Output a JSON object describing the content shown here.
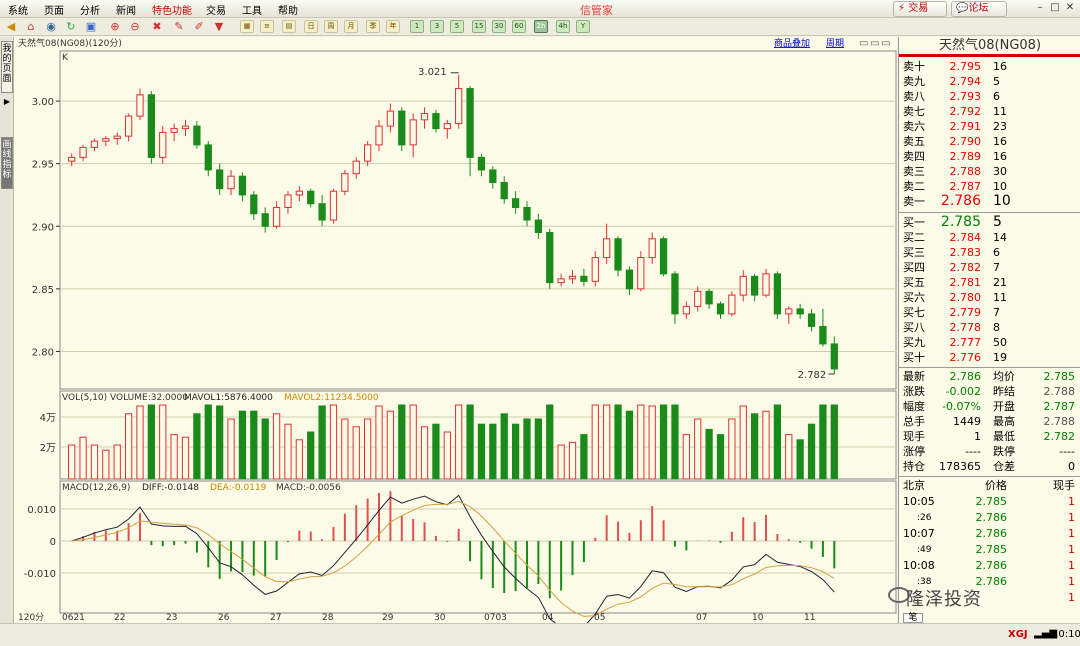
{
  "menu": [
    "系统",
    "页面",
    "分析",
    "新闻",
    "特色功能",
    "交易",
    "工具",
    "帮助"
  ],
  "app_title": "信管家",
  "trade_button": "交易",
  "forum_button": "论坛",
  "toolbar": {
    "icons": [
      "arrow-left-icon",
      "home-icon",
      "globe-icon",
      "refresh-icon",
      "zoom-in-icon",
      "zoom-out-icon",
      "pencil-icon",
      "paint-icon",
      "funnel-icon",
      "grid-icon",
      "list-icon",
      "chart-icon",
      "calendar-icon",
      "week-icon",
      "month-icon",
      "bar-icon"
    ],
    "periods": [
      "1",
      "3",
      "5",
      "15",
      "30",
      "60",
      "2h",
      "4h",
      "Y"
    ],
    "selected_period": "2h"
  },
  "left_tabs": [
    "我的页面",
    "画线指标"
  ],
  "chart": {
    "header_text": "天然气08(NG08)(120分)",
    "k_label": "K",
    "overlay_label": "商品叠加",
    "cycle_label": "周期",
    "price_axis": [
      "3.00",
      "2.95",
      "2.90",
      "2.85",
      "2.80"
    ],
    "high_annotation": "3.021",
    "low_annotation": "2.782",
    "vol_header": {
      "name": "VOL(5,10) VOLUME:32.0000",
      "mavol1": "MAVOL1:5876.4000",
      "mavol2": "MAVOL2:11234.5000"
    },
    "vol_axis": [
      "4万",
      "2万"
    ],
    "macd_header": {
      "name": "MACD(12,26,9)",
      "diff": "DIFF:-0.0148",
      "dea": "DEA:-0.0119",
      "macd": "MACD:-0.0056"
    },
    "macd_axis": [
      "0.010",
      "0",
      "-0.010"
    ],
    "date_axis": {
      "period": "120分",
      "labels": [
        "0621",
        "22",
        "23",
        "26",
        "27",
        "28",
        "29",
        "30",
        "0703",
        "04",
        "05",
        "07",
        "10",
        "11"
      ]
    }
  },
  "chart_data": {
    "type": "candlestick",
    "title": "天然气08(NG08)(120分)",
    "ylim": [
      2.77,
      3.04
    ],
    "notes": "Approximate OHLC values read from 120-minute candlestick chart",
    "candles": [
      [
        2.952,
        2.958,
        2.948,
        2.955
      ],
      [
        2.955,
        2.965,
        2.952,
        2.963
      ],
      [
        2.963,
        2.97,
        2.96,
        2.968
      ],
      [
        2.968,
        2.972,
        2.964,
        2.97
      ],
      [
        2.97,
        2.975,
        2.965,
        2.972
      ],
      [
        2.972,
        2.99,
        2.968,
        2.988
      ],
      [
        2.988,
        3.01,
        2.985,
        3.005
      ],
      [
        3.005,
        3.008,
        2.95,
        2.955
      ],
      [
        2.955,
        2.98,
        2.95,
        2.975
      ],
      [
        2.975,
        2.982,
        2.968,
        2.978
      ],
      [
        2.978,
        2.985,
        2.972,
        2.98
      ],
      [
        2.98,
        2.984,
        2.962,
        2.965
      ],
      [
        2.965,
        2.968,
        2.94,
        2.945
      ],
      [
        2.945,
        2.95,
        2.925,
        2.93
      ],
      [
        2.93,
        2.945,
        2.925,
        2.94
      ],
      [
        2.94,
        2.943,
        2.92,
        2.925
      ],
      [
        2.925,
        2.928,
        2.905,
        2.91
      ],
      [
        2.91,
        2.915,
        2.895,
        2.9
      ],
      [
        2.9,
        2.92,
        2.898,
        2.915
      ],
      [
        2.915,
        2.928,
        2.91,
        2.925
      ],
      [
        2.925,
        2.932,
        2.92,
        2.928
      ],
      [
        2.928,
        2.93,
        2.915,
        2.918
      ],
      [
        2.918,
        2.925,
        2.9,
        2.905
      ],
      [
        2.905,
        2.93,
        2.902,
        2.928
      ],
      [
        2.928,
        2.945,
        2.925,
        2.942
      ],
      [
        2.942,
        2.955,
        2.938,
        2.952
      ],
      [
        2.952,
        2.968,
        2.948,
        2.965
      ],
      [
        2.965,
        2.985,
        2.96,
        2.98
      ],
      [
        2.98,
        2.998,
        2.975,
        2.992
      ],
      [
        2.992,
        2.995,
        2.96,
        2.965
      ],
      [
        2.965,
        2.99,
        2.955,
        2.985
      ],
      [
        2.985,
        2.995,
        2.978,
        2.99
      ],
      [
        2.99,
        2.993,
        2.975,
        2.978
      ],
      [
        2.978,
        2.985,
        2.97,
        2.982
      ],
      [
        2.982,
        3.021,
        2.978,
        3.01
      ],
      [
        3.01,
        3.012,
        2.94,
        2.955
      ],
      [
        2.955,
        2.958,
        2.94,
        2.945
      ],
      [
        2.945,
        2.948,
        2.93,
        2.935
      ],
      [
        2.935,
        2.94,
        2.918,
        2.922
      ],
      [
        2.922,
        2.928,
        2.91,
        2.915
      ],
      [
        2.915,
        2.92,
        2.9,
        2.905
      ],
      [
        2.905,
        2.91,
        2.89,
        2.895
      ],
      [
        2.895,
        2.898,
        2.85,
        2.855
      ],
      [
        2.855,
        2.862,
        2.852,
        2.858
      ],
      [
        2.858,
        2.865,
        2.854,
        2.86
      ],
      [
        2.86,
        2.866,
        2.852,
        2.856
      ],
      [
        2.856,
        2.88,
        2.852,
        2.875
      ],
      [
        2.875,
        2.902,
        2.87,
        2.89
      ],
      [
        2.89,
        2.892,
        2.86,
        2.865
      ],
      [
        2.865,
        2.868,
        2.845,
        2.85
      ],
      [
        2.85,
        2.88,
        2.848,
        2.875
      ],
      [
        2.875,
        2.895,
        2.87,
        2.89
      ],
      [
        2.89,
        2.892,
        2.86,
        2.862
      ],
      [
        2.862,
        2.864,
        2.822,
        2.83
      ],
      [
        2.83,
        2.84,
        2.826,
        2.836
      ],
      [
        2.836,
        2.852,
        2.832,
        2.848
      ],
      [
        2.848,
        2.85,
        2.834,
        2.838
      ],
      [
        2.838,
        2.84,
        2.826,
        2.83
      ],
      [
        2.83,
        2.848,
        2.828,
        2.845
      ],
      [
        2.845,
        2.865,
        2.84,
        2.86
      ],
      [
        2.86,
        2.862,
        2.84,
        2.845
      ],
      [
        2.845,
        2.866,
        2.843,
        2.862
      ],
      [
        2.862,
        2.864,
        2.826,
        2.83
      ],
      [
        2.83,
        2.836,
        2.822,
        2.834
      ],
      [
        2.834,
        2.838,
        2.826,
        2.83
      ],
      [
        2.83,
        2.834,
        2.816,
        2.82
      ],
      [
        2.82,
        2.834,
        2.804,
        2.806
      ],
      [
        2.806,
        2.812,
        2.782,
        2.786
      ]
    ]
  },
  "quote": {
    "title": "天然气08(NG08)",
    "asks": [
      {
        "label": "卖十",
        "price": "2.795",
        "vol": "16"
      },
      {
        "label": "卖九",
        "price": "2.794",
        "vol": "5"
      },
      {
        "label": "卖八",
        "price": "2.793",
        "vol": "6"
      },
      {
        "label": "卖七",
        "price": "2.792",
        "vol": "11"
      },
      {
        "label": "卖六",
        "price": "2.791",
        "vol": "23"
      },
      {
        "label": "卖五",
        "price": "2.790",
        "vol": "16"
      },
      {
        "label": "卖四",
        "price": "2.789",
        "vol": "16"
      },
      {
        "label": "卖三",
        "price": "2.788",
        "vol": "30"
      },
      {
        "label": "卖二",
        "price": "2.787",
        "vol": "10"
      },
      {
        "label": "卖一",
        "price": "2.786",
        "vol": "10"
      }
    ],
    "bids": [
      {
        "label": "买一",
        "price": "2.785",
        "vol": "5"
      },
      {
        "label": "买二",
        "price": "2.784",
        "vol": "14"
      },
      {
        "label": "买三",
        "price": "2.783",
        "vol": "6"
      },
      {
        "label": "买四",
        "price": "2.782",
        "vol": "7"
      },
      {
        "label": "买五",
        "price": "2.781",
        "vol": "21"
      },
      {
        "label": "买六",
        "price": "2.780",
        "vol": "11"
      },
      {
        "label": "买七",
        "price": "2.779",
        "vol": "7"
      },
      {
        "label": "买八",
        "price": "2.778",
        "vol": "8"
      },
      {
        "label": "买九",
        "price": "2.777",
        "vol": "50"
      },
      {
        "label": "买十",
        "price": "2.776",
        "vol": "19"
      }
    ],
    "stats": [
      {
        "l1": "最新",
        "v1": "2.786",
        "c1": "grn",
        "l2": "均价",
        "v2": "2.785",
        "c2": "grn"
      },
      {
        "l1": "涨跌",
        "v1": "-0.002",
        "c1": "grn",
        "l2": "昨结",
        "v2": "2.788",
        "c2": "gray"
      },
      {
        "l1": "幅度",
        "v1": "-0.07%",
        "c1": "grn",
        "l2": "开盘",
        "v2": "2.787",
        "c2": "grn"
      },
      {
        "l1": "总手",
        "v1": "1449",
        "c1": "blk",
        "l2": "最高",
        "v2": "2.788",
        "c2": "gray"
      },
      {
        "l1": "现手",
        "v1": "1",
        "c1": "blk",
        "l2": "最低",
        "v2": "2.782",
        "c2": "grn"
      },
      {
        "l1": "涨停",
        "v1": "----",
        "c1": "blk",
        "l2": "跌停",
        "v2": "----",
        "c2": "blk"
      },
      {
        "l1": "持仓",
        "v1": "178365",
        "c1": "blk",
        "l2": "仓差",
        "v2": "0",
        "c2": "blk"
      }
    ],
    "ticks_header": {
      "time": "北京",
      "price": "价格",
      "qty": "现手"
    },
    "ticks": [
      {
        "time": "10:05",
        "price": "2.785",
        "qty": "1"
      },
      {
        "time": ":26",
        "price": "2.786",
        "qty": "1"
      },
      {
        "time": "10:07",
        "price": "2.786",
        "qty": "1"
      },
      {
        "time": ":49",
        "price": "2.785",
        "qty": "1"
      },
      {
        "time": "10:08",
        "price": "2.786",
        "qty": "1"
      },
      {
        "time": ":38",
        "price": "2.786",
        "qty": "1"
      },
      {
        "time": "",
        "price": "",
        "qty": "1"
      }
    ],
    "ticks_tab": "笔"
  },
  "status": {
    "logo": "XGJ",
    "time": "10:10"
  },
  "watermark": "隆泽投资"
}
